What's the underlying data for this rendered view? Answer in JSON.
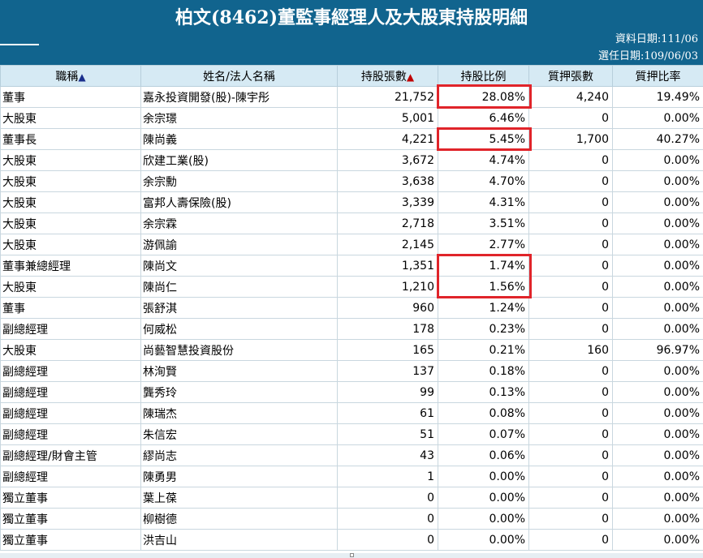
{
  "header": {
    "title": "柏文(8462)董監事經理人及大股東持股明細",
    "data_date": "資料日期:111/06",
    "election_date": "選任日期:109/06/03"
  },
  "columns": [
    {
      "label": "職稱",
      "arrow": "▲"
    },
    {
      "label": "姓名/法人名稱",
      "arrow": ""
    },
    {
      "label": "持股張數",
      "arrow": "▲"
    },
    {
      "label": "持股比例",
      "arrow": ""
    },
    {
      "label": "質押張數",
      "arrow": ""
    },
    {
      "label": "質押比率",
      "arrow": ""
    }
  ],
  "rows": [
    [
      "董事",
      "嘉永投資開發(股)-陳宇彤",
      "21,752",
      "28.08%",
      "4,240",
      "19.49%"
    ],
    [
      "大股東",
      "余宗璟",
      "5,001",
      "6.46%",
      "0",
      "0.00%"
    ],
    [
      "董事長",
      "陳尚義",
      "4,221",
      "5.45%",
      "1,700",
      "40.27%"
    ],
    [
      "大股東",
      "欣建工業(股)",
      "3,672",
      "4.74%",
      "0",
      "0.00%"
    ],
    [
      "大股東",
      "余宗勳",
      "3,638",
      "4.70%",
      "0",
      "0.00%"
    ],
    [
      "大股東",
      "富邦人壽保險(股)",
      "3,339",
      "4.31%",
      "0",
      "0.00%"
    ],
    [
      "大股東",
      "余宗霖",
      "2,718",
      "3.51%",
      "0",
      "0.00%"
    ],
    [
      "大股東",
      "游佩諭",
      "2,145",
      "2.77%",
      "0",
      "0.00%"
    ],
    [
      "董事兼總經理",
      "陳尚文",
      "1,351",
      "1.74%",
      "0",
      "0.00%"
    ],
    [
      "大股東",
      "陳尚仁",
      "1,210",
      "1.56%",
      "0",
      "0.00%"
    ],
    [
      "董事",
      "張舒淇",
      "960",
      "1.24%",
      "0",
      "0.00%"
    ],
    [
      "副總經理",
      "何威松",
      "178",
      "0.23%",
      "0",
      "0.00%"
    ],
    [
      "大股東",
      "尚藝智慧投資股份",
      "165",
      "0.21%",
      "160",
      "96.97%"
    ],
    [
      "副總經理",
      "林洵賢",
      "137",
      "0.18%",
      "0",
      "0.00%"
    ],
    [
      "副總經理",
      "龔秀玲",
      "99",
      "0.13%",
      "0",
      "0.00%"
    ],
    [
      "副總經理",
      "陳瑞杰",
      "61",
      "0.08%",
      "0",
      "0.00%"
    ],
    [
      "副總經理",
      "朱信宏",
      "51",
      "0.07%",
      "0",
      "0.00%"
    ],
    [
      "副總經理/財會主管",
      "繆尚志",
      "43",
      "0.06%",
      "0",
      "0.00%"
    ],
    [
      "副總經理",
      "陳勇男",
      "1",
      "0.00%",
      "0",
      "0.00%"
    ],
    [
      "獨立董事",
      "葉上葆",
      "0",
      "0.00%",
      "0",
      "0.00%"
    ],
    [
      "獨立董事",
      "柳樹德",
      "0",
      "0.00%",
      "0",
      "0.00%"
    ],
    [
      "獨立董事",
      "洪吉山",
      "0",
      "0.00%",
      "0",
      "0.00%"
    ]
  ],
  "colors": {
    "header_bg": "#11648e",
    "column_header_bg": "#d6eaf4",
    "highlight_border": "#e0242a"
  }
}
